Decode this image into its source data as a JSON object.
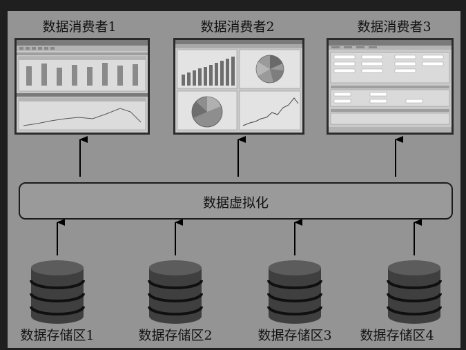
{
  "consumers": [
    {
      "label": "数据消费者1"
    },
    {
      "label": "数据消费者2"
    },
    {
      "label": "数据消费者3"
    }
  ],
  "virtualization": {
    "label": "数据虚拟化"
  },
  "stores": [
    {
      "label": "数据存储区1"
    },
    {
      "label": "数据存储区2"
    },
    {
      "label": "数据存储区3"
    },
    {
      "label": "数据存储区4"
    }
  ],
  "colors": {
    "background": "#949494",
    "frame": "#1f1f1f",
    "ink": "#111111"
  }
}
